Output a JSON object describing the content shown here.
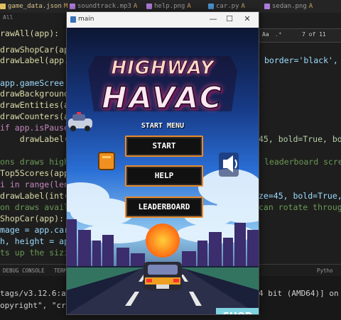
{
  "tabs": [
    {
      "label": "game_data.json",
      "status": "M",
      "color": "#e0c060"
    },
    {
      "label": "soundtrack.mp3",
      "status": "A",
      "color": "#b07ad8"
    },
    {
      "label": "help.png",
      "status": "A",
      "color": "#b07ad8"
    },
    {
      "label": "car.py",
      "status": "A",
      "color": "#4a90d0"
    },
    {
      "label": "sedan.png",
      "status": "A",
      "color": "#b07ad8"
    }
  ],
  "breadcrumb": "All",
  "find_widget": {
    "match_count": "7 of 11",
    "aa": "Aa"
  },
  "code_lines": [
    "rawAll(app):",
    "drawShopCar(ap",
    "drawLabel(app.",
    "app.gameScree",
    "drawBackground",
    "drawEntities(a",
    "drawCounters(a",
    "if app.isPause",
    "    drawLabel(",
    "ons draws high",
    "Top5Scores(app",
    "i in range(len",
    "drawLabel(int(",
    "on draws avail",
    "ShopCar(app):",
    "mage = app.car",
    "h, height = ap",
    "ts up the sizi"
  ],
  "code_right": [
    {
      "text": "border='black', ",
      "row": 2
    },
    {
      "text": "45, bold=True, bo",
      "row": 8
    },
    {
      "text": "leaderboard scre",
      "row": 9
    },
    {
      "text": "ze=45, bold=True,",
      "row": 12
    },
    {
      "text": "can rotate throug",
      "row": 13
    }
  ],
  "panel_tabs": [
    "DEBUG CONSOLE",
    "TERM"
  ],
  "panel_right": "Pytho",
  "terminal_lines": [
    {
      "text": "tags/v3.12.6:a4",
      "right": "4 bit (AMD64)] on w"
    },
    {
      "text": "opyright\", \"cre",
      "right": ""
    }
  ],
  "window": {
    "title": "main",
    "minimize": "—",
    "maximize": "☐",
    "close": "✕"
  },
  "game": {
    "logo_line1": "HIGHWAY",
    "logo_line2": "HAVAC",
    "menu_heading": "START MENU",
    "buttons": [
      "START",
      "HELP",
      "LEADERBOARD"
    ],
    "shop_label": "SHOP"
  },
  "colors": {
    "accent_orange": "#e88a2c",
    "sky_top": "#0d1633",
    "sky_mid": "#2a6fd6",
    "sun": "#ff7a1a",
    "shop_bg": "#7fd3e0"
  },
  "icons": [
    "json-file-icon",
    "audio-file-icon",
    "image-file-icon",
    "python-file-icon",
    "speaker-icon",
    "help-icon",
    "police-car-icon",
    "player-car-icon"
  ]
}
